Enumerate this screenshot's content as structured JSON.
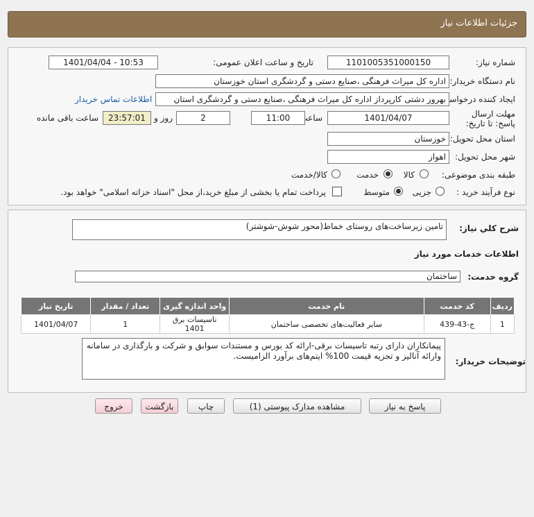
{
  "header": {
    "title": "جزئیات اطلاعات نیاز"
  },
  "info": {
    "need_number_label": "شماره نیاز:",
    "need_number": "1101005351000150",
    "announce_label": "تاریخ و ساعت اعلان عمومی:",
    "announce_value": "1401/04/04 - 10:53",
    "buyer_org_label": "نام دستگاه خریدار:",
    "buyer_org": "اداره کل میراث فرهنگی ،صنایع دستی و گردشگری استان خوزستان",
    "creator_label": "ایجاد کننده درخواست:",
    "creator": "بهروز دشتی کارپرداز اداره کل میراث فرهنگی ،صنایع دستی و گردشگری استان",
    "contact_link": "اطلاعات تماس خریدار",
    "deadline_label": "مهلت ارسال پاسخ: تا تاریخ:",
    "deadline_date": "1401/04/07",
    "time_label": "ساعت",
    "deadline_time": "11:00",
    "days_value": "2",
    "days_label": "روز و",
    "remaining_time": "23:57:01",
    "remaining_label": "ساعت باقی مانده",
    "province_label": "استان محل تحویل:",
    "province": "خوزستان",
    "city_label": "شهر محل تحویل:",
    "city": "اهواز",
    "category_label": "طبقه بندی موضوعی:",
    "category_options": [
      "کالا",
      "خدمت",
      "کالا/خدمت"
    ],
    "category_selected": "خدمت",
    "process_label": "نوع فرآیند خرید :",
    "process_options": [
      "جزیی",
      "متوسط"
    ],
    "process_selected": "متوسط",
    "treasury_note": "پرداخت تمام یا بخشی از مبلغ خرید،از محل \"اسناد خزانه اسلامی\" خواهد بود."
  },
  "summary": {
    "label": "شرح کلي نياز:",
    "text": "تامین زیرساخت‌های روستای خماط(محور شوش-شوشتر)"
  },
  "services": {
    "heading": "اطلاعات خدمات مورد نیاز",
    "group_label": "گروه خدمت:",
    "group_value": "ساختمان",
    "columns": [
      "ردیف",
      "کد خدمت",
      "نام خدمت",
      "واحد اندازه گیری",
      "تعداد / مقدار",
      "تاریخ نیاز"
    ],
    "rows": [
      [
        "1",
        "ج-43-439",
        "سایر فعالیت‌های تخصصی ساختمان",
        "تاسیسات برق 1401",
        "1",
        "1401/04/07"
      ]
    ]
  },
  "buyer_notes": {
    "label": "توضیحات خریدار:",
    "text": "پیمانکاران دارای رتبه تاسیسات برقی-ارائه کد بورس و مستندات سوابق و شرکت و بارگذاری در سامانه وارائه آنالیز و تجزیه قیمت 100% ایتم‌های برآورد الزامیست."
  },
  "buttons": {
    "reply": "پاسخ به نیاز",
    "attachments": "مشاهده مدارک پیوستی (1)",
    "print": "چاپ",
    "back": "بازگشت",
    "exit": "خروج"
  },
  "colors": {
    "header": "#8f7451",
    "table_header": "#757575",
    "time_box": "#f1edc6",
    "link": "#1c5ea8"
  }
}
